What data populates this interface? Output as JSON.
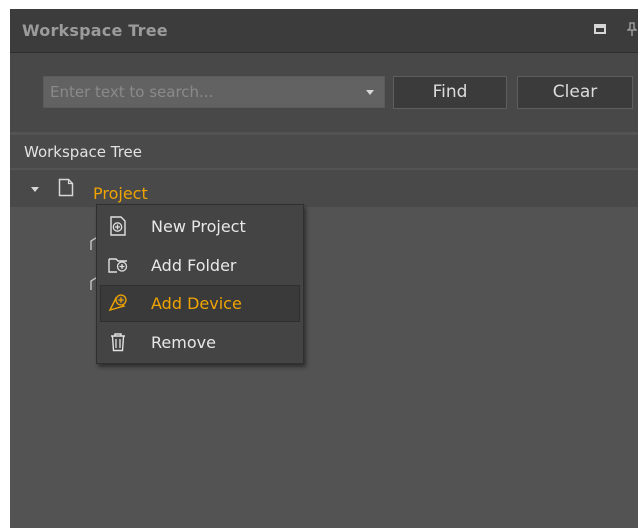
{
  "panel": {
    "title": "Workspace Tree",
    "window_icons": [
      "restore-icon",
      "pin-icon"
    ]
  },
  "search": {
    "placeholder": "Enter text to search...",
    "value": "",
    "find_label": "Find",
    "clear_label": "Clear"
  },
  "tree": {
    "header": "Workspace Tree",
    "root": {
      "label": "Project",
      "expanded": true,
      "selected": true,
      "icon": "document-icon"
    }
  },
  "context_menu": {
    "items": [
      {
        "label": "New Project",
        "icon": "new-project-icon",
        "highlighted": false
      },
      {
        "label": "Add Folder",
        "icon": "add-folder-icon",
        "highlighted": false
      },
      {
        "label": "Add Device",
        "icon": "add-device-icon",
        "highlighted": true
      },
      {
        "label": "Remove",
        "icon": "trash-icon",
        "highlighted": false
      }
    ]
  },
  "colors": {
    "accent": "#f0a400",
    "panel_bg": "#535353",
    "title_bg": "#3c3c3c",
    "menu_bg": "#444444"
  }
}
